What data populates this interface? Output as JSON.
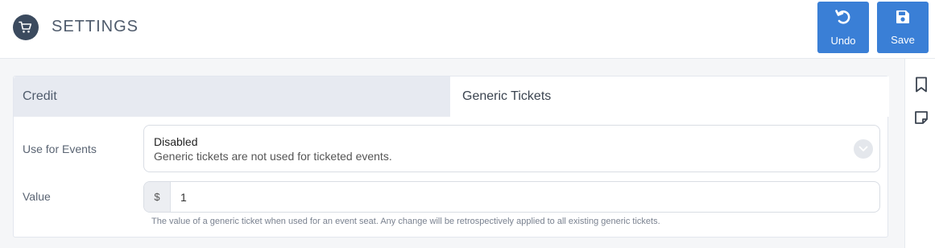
{
  "header": {
    "title": "SETTINGS",
    "undo_label": "Undo",
    "save_label": "Save",
    "accent": "#3a7fd6"
  },
  "tabs": [
    {
      "label": "Credit",
      "active": false
    },
    {
      "label": "Generic Tickets",
      "active": true
    }
  ],
  "form": {
    "use_for_events": {
      "label": "Use for Events",
      "selected_title": "Disabled",
      "selected_description": "Generic tickets are not used for ticketed events."
    },
    "value": {
      "label": "Value",
      "prefix": "$",
      "input_value": "1",
      "help": "The value of a generic ticket when used for an event seat. Any change will be retrospectively applied to all existing generic tickets."
    }
  },
  "icons": {
    "logo": "cart-icon",
    "undo": "undo-icon",
    "save": "floppy-disk-icon",
    "rail": [
      "bookmark-icon",
      "note-icon"
    ]
  }
}
